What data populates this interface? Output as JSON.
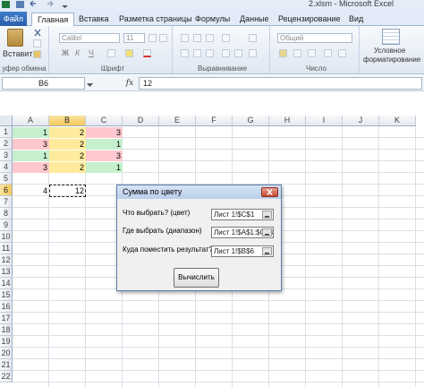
{
  "window": {
    "title": "2.xlsm  -  Microsoft Excel"
  },
  "tabs": {
    "file": "Файл",
    "items": [
      "Главная",
      "Вставка",
      "Разметка страницы",
      "Формулы",
      "Данные",
      "Рецензирование",
      "Вид"
    ],
    "active_index": 0
  },
  "ribbon": {
    "clipboard": {
      "paste_label": "Вставить",
      "group_label": "уфер обмена"
    },
    "font": {
      "name": "Calibri",
      "size": "11",
      "group_label": "Шрифт",
      "bold": "Ж",
      "italic": "К",
      "underline": "Ч"
    },
    "alignment": {
      "group_label": "Выравнивание"
    },
    "number": {
      "format": "Общий",
      "group_label": "Число"
    },
    "styles": {
      "conditional_line1": "Условное",
      "conditional_line2": "форматирование"
    }
  },
  "formula_bar": {
    "name_box": "B6",
    "fx_label": "fx",
    "formula": "12"
  },
  "sheet": {
    "columns": [
      "A",
      "B",
      "C",
      "D",
      "E",
      "F",
      "G",
      "H",
      "I",
      "J",
      "K"
    ],
    "selected_column": "B",
    "rows": [
      "1",
      "2",
      "3",
      "4",
      "5",
      "6",
      "7",
      "8",
      "9",
      "10",
      "11",
      "12",
      "13",
      "14",
      "15",
      "16",
      "17",
      "18",
      "19",
      "20",
      "21",
      "22"
    ],
    "selected_row": "6",
    "cells": {
      "A1": "1",
      "B1": "2",
      "C1": "3",
      "A2": "3",
      "B2": "2",
      "C2": "1",
      "A3": "1",
      "B3": "2",
      "C3": "3",
      "A4": "3",
      "B4": "2",
      "C4": "1",
      "A6": "4",
      "B6": "12"
    },
    "colors": {
      "green": "#c6efce",
      "red": "#ffc7ce",
      "yellow": "#ffeb9c"
    }
  },
  "dialog": {
    "title": "Сумма по цвету",
    "pick_label": "Что выбрать? (цвет)",
    "pick_value": "Лист 1!$C$1",
    "range_label": "Где выбрать (диапазон)",
    "range_value": "Лист 1!$A$1:$C$4",
    "output_label": "Куда поместить результат?",
    "output_value": "Лист 1!$B$6",
    "calc_button": "Вычислить"
  }
}
